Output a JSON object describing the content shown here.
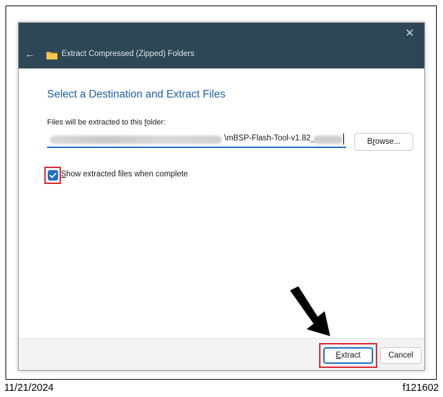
{
  "dialog": {
    "title": "Extract Compressed (Zipped) Folders",
    "close_glyph": "✕",
    "back_glyph": "←",
    "heading": "Select a Destination and Extract Files",
    "destination": {
      "label_prefix": "Files will be extracted to this ",
      "label_underlined": "f",
      "label_suffix": "older:",
      "path_visible": "\\mBSP-Flash-Tool-v1.82_",
      "path_obscured": true
    },
    "browse": {
      "prefix": "B",
      "underlined": "r",
      "suffix": "owse..."
    },
    "show_files": {
      "checked": true,
      "label_underlined": "S",
      "label_rest": "how extracted files when complete"
    },
    "buttons": {
      "extract": {
        "underlined": "E",
        "rest": "xtract"
      },
      "cancel": "Cancel"
    }
  },
  "annotations": {
    "highlight_color": "#e0262f",
    "arrow_target": "extract-button"
  },
  "footer": {
    "date": "11/21/2024",
    "figure_code": "f121602"
  },
  "colors": {
    "titlebar": "#2e4756",
    "accent": "#1f6fc5",
    "heading": "#1f5fa8"
  },
  "icons": {
    "back": "arrow-left-icon",
    "folder": "zip-folder-icon",
    "close": "close-icon",
    "checkmark": "checkmark-icon",
    "pointer": "pointer-arrow-icon"
  }
}
